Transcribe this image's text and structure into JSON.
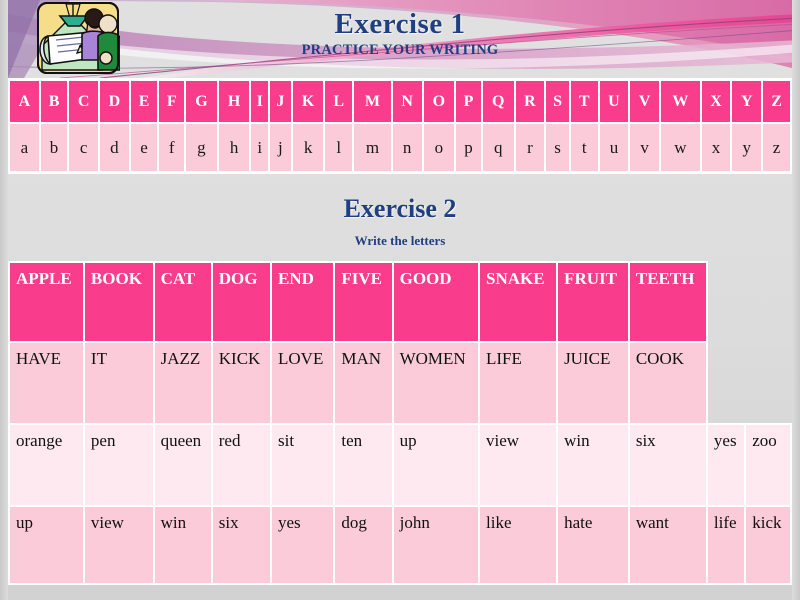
{
  "theme": {
    "accent_pink": "#fa3c8c",
    "row_pink": "#fbcbda",
    "row_pink_light": "#fde9ef",
    "heading_blue": "#1f3f7f",
    "background_gray": "#dcdcdc"
  },
  "header": {
    "icon_name": "writing-clipart-icon",
    "title": "Exercise 1",
    "subtitle": "PRACTICE YOUR WRITING"
  },
  "exercise1": {
    "uppercase": [
      "A",
      "B",
      "C",
      "D",
      "E",
      "F",
      "G",
      "H",
      "I",
      "J",
      "K",
      "L",
      "M",
      "N",
      "O",
      "P",
      "Q",
      "R",
      "S",
      "T",
      "U",
      "V",
      "W",
      "X",
      "Y",
      "Z"
    ],
    "lowercase": [
      "a",
      "b",
      "c",
      "d",
      "e",
      "f",
      "g",
      "h",
      "i",
      "j",
      "k",
      "l",
      "m",
      "n",
      "o",
      "p",
      "q",
      "r",
      "s",
      "t",
      "u",
      "v",
      "w",
      "x",
      "y",
      "z"
    ]
  },
  "exercise2": {
    "title": "Exercise 2",
    "subtitle": "Write the letters",
    "rows": [
      {
        "style": "header",
        "cells": [
          "APPLE",
          "BOOK",
          "CAT",
          "DOG",
          "END",
          "FIVE",
          "GOOD",
          "SNAKE",
          "FRUIT",
          "TEETH"
        ]
      },
      {
        "style": "a",
        "cells": [
          "HAVE",
          "IT",
          "JAZZ",
          "KICK",
          "LOVE",
          "MAN",
          "WOMEN",
          "LIFE",
          "JUICE",
          "COOK"
        ]
      },
      {
        "style": "b",
        "cells": [
          "orange",
          "pen",
          "queen",
          "red",
          "sit",
          "ten",
          "up",
          "view",
          "win",
          "six",
          "yes",
          "zoo"
        ]
      },
      {
        "style": "c",
        "cells": [
          "up",
          "view",
          "win",
          "six",
          "yes",
          "dog",
          "john",
          "like",
          "hate",
          "want",
          "life",
          "kick"
        ]
      }
    ]
  }
}
